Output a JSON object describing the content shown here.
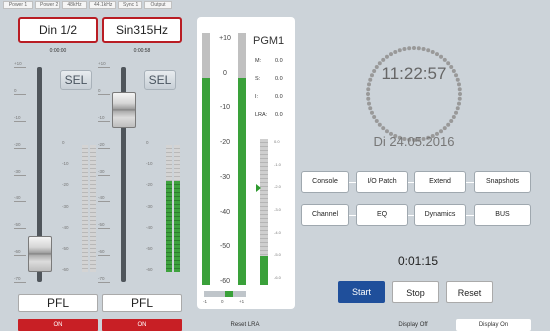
{
  "status_bar": [
    "Power 1",
    "Power 2",
    "48kHz",
    "44.1kHz",
    "Sync 1",
    "Output"
  ],
  "channels": [
    {
      "name": "Din 1/2",
      "time": "0:00:00",
      "sel": "SEL",
      "pfl": "PFL",
      "on": "ON",
      "fader_level": 0.13,
      "meter_level": 0.0
    },
    {
      "name": "Sin315Hz",
      "time": "0:00:58",
      "sel": "SEL",
      "pfl": "PFL",
      "on": "ON",
      "fader_level": 0.8,
      "meter_level": 0.72
    }
  ],
  "fader_scale": [
    "+10",
    "0",
    "-10",
    "-20",
    "-30",
    "-40",
    "-50",
    "-60",
    "-70"
  ],
  "meter_scale": [
    "0",
    "-10",
    "-20",
    "-30",
    "-40",
    "-50",
    "-60"
  ],
  "pgm": {
    "title": "PGM1",
    "scale": [
      "+10",
      "0",
      "-10",
      "-20",
      "-30",
      "-40",
      "-50",
      "-60"
    ],
    "small_scale": [
      "0.0",
      "-1.0",
      "-2.0",
      "-3.0",
      "-4.0",
      "-5.0",
      "-6.0"
    ],
    "stats": [
      {
        "label": "M:",
        "value": "0.0"
      },
      {
        "label": "S:",
        "value": "0.0"
      },
      {
        "label": "I:",
        "value": "0.0"
      },
      {
        "label": "LRA:",
        "value": "0.0"
      }
    ],
    "balance_labels": [
      "-1",
      "0",
      "+1"
    ],
    "level_left": 0.82,
    "level_right": 0.82,
    "loudness_level": 0.2,
    "balance": 0.7,
    "reset_lra": "Reset LRA"
  },
  "clock": {
    "time": "11:22:57",
    "date": "Di 24.05.2016"
  },
  "nav_rows": [
    [
      "Console",
      "I/O Patch",
      "Extend",
      "Snapshots"
    ],
    [
      "Channel",
      "EQ",
      "Dynamics",
      "BUS"
    ]
  ],
  "timer": {
    "value": "0:01:15",
    "start": "Start",
    "stop": "Stop",
    "reset": "Reset"
  },
  "footer": {
    "display_off": "Display Off",
    "display_on": "Display On"
  },
  "colors": {
    "accent_red": "#c81f25",
    "meter_green": "#3aa13a",
    "start_blue": "#1f4f9b"
  }
}
